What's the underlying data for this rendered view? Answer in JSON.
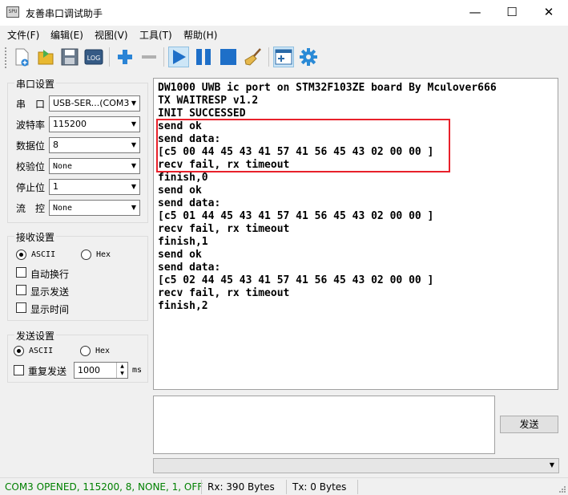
{
  "window": {
    "icon_text": "SPU",
    "title": "友善串口调试助手",
    "minimize": "—",
    "maximize": "☐",
    "close": "✕"
  },
  "menu": [
    "文件(F)",
    "编辑(E)",
    "视图(V)",
    "工具(T)",
    "帮助(H)"
  ],
  "toolbar": {
    "icons": [
      "new-doc-icon",
      "open-folder-icon",
      "save-icon",
      "log-icon",
      "zoom-in-icon",
      "zoom-out-icon",
      "play-icon",
      "pause-icon",
      "stop-icon",
      "broom-clear-icon",
      "add-window-icon",
      "settings-gear-icon"
    ],
    "log_text": "LOG",
    "colors": {
      "blue": "#1e6fc8",
      "plus": "#2a84d6",
      "minus": "#b0b0b0"
    }
  },
  "serial": {
    "title": "串口设置",
    "port_label": "串　口",
    "port_value": "USB-SER...(COM3",
    "baud_label": "波特率",
    "baud_value": "115200",
    "data_label": "数据位",
    "data_value": "8",
    "parity_label": "校验位",
    "parity_value": "None",
    "stop_label": "停止位",
    "stop_value": "1",
    "flow_label": "流　控",
    "flow_value": "None"
  },
  "receive": {
    "title": "接收设置",
    "ascii": "ASCII",
    "hex": "Hex",
    "auto_wrap": "自动换行",
    "show_send": "显示发送",
    "show_time": "显示时间"
  },
  "send_settings": {
    "title": "发送设置",
    "ascii": "ASCII",
    "hex": "Hex",
    "repeat": "重复发送",
    "interval": "1000",
    "unit": "ms"
  },
  "recv_lines": [
    "DW1000 UWB ic port on STM32F103ZE board By Mculover666",
    "TX WAITRESP v1.2",
    "INIT SUCCESSED",
    "send ok",
    "send data:",
    "[c5 00 44 45 43 41 57 41 56 45 43 02 00 00 ]",
    "recv fail, rx timeout",
    "finish,0",
    "send ok",
    "send data:",
    "[c5 01 44 45 43 41 57 41 56 45 43 02 00 00 ]",
    "recv fail, rx timeout",
    "finish,1",
    "send ok",
    "send data:",
    "[c5 02 44 45 43 41 57 41 56 45 43 02 00 00 ]",
    "recv fail, rx timeout",
    "finish,2"
  ],
  "send_button": "发送",
  "status": {
    "port": "COM3 OPENED, 115200, 8, NONE, 1, OFF",
    "port_color": "#008000",
    "rx": "Rx: 390 Bytes",
    "tx": "Tx: 0 Bytes"
  }
}
